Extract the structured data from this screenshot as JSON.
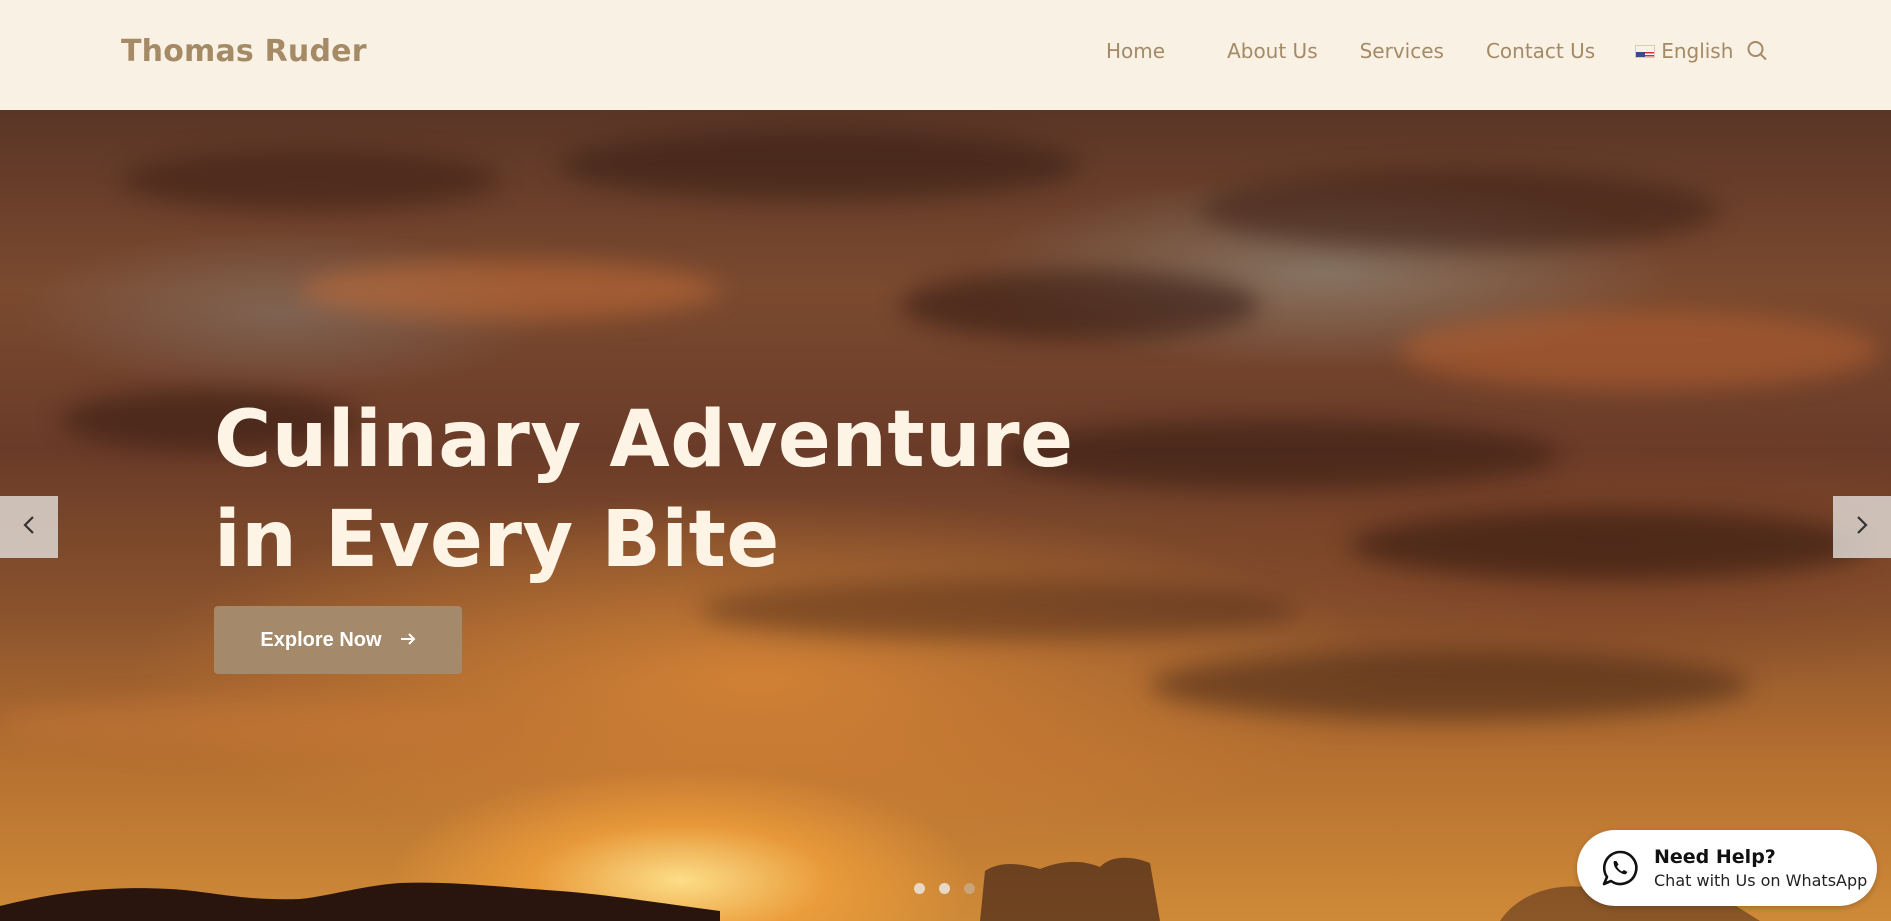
{
  "header": {
    "brand": "Thomas Ruder",
    "nav": [
      {
        "label": "Home"
      },
      {
        "label": "About Us"
      },
      {
        "label": "Services"
      },
      {
        "label": "Contact Us"
      }
    ],
    "language": "English",
    "search_icon": "search-icon",
    "flag_icon": "us-flag-icon"
  },
  "hero": {
    "title_line1": "Culinary Adventure",
    "title_line2": "in Every Bite",
    "cta_label": "Explore Now",
    "slides": 3,
    "active_slide": 3
  },
  "whatsapp": {
    "title": "Need Help?",
    "subtitle": "Chat with Us on WhatsApp"
  },
  "colors": {
    "header_bg": "#f9f1e4",
    "brand": "#a58a66",
    "cta_bg": "#a4896a",
    "title": "#fdf4e6"
  }
}
